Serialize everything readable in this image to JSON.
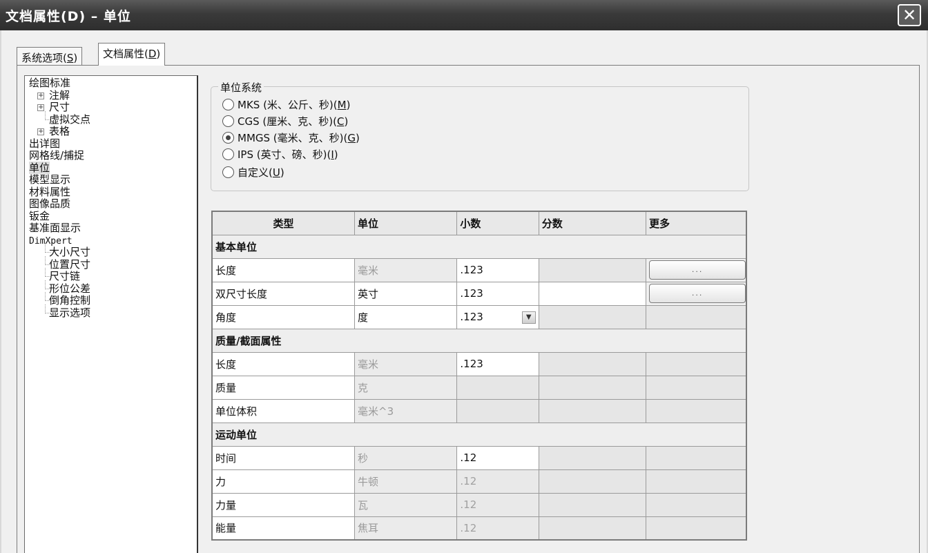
{
  "window": {
    "title": "文档属性(D) – 单位"
  },
  "tabs": [
    "系统选项(S)",
    "文档属性(D)"
  ],
  "tree": {
    "items": [
      {
        "label": "绘图标准",
        "level": 0
      },
      {
        "label": "注解",
        "level": 1,
        "expandable": true
      },
      {
        "label": "尺寸",
        "level": 1,
        "expandable": true
      },
      {
        "label": "虚拟交点",
        "level": 1
      },
      {
        "label": "表格",
        "level": 1,
        "expandable": true
      },
      {
        "label": "出详图",
        "level": 0
      },
      {
        "label": "网格线/捕捉",
        "level": 0
      },
      {
        "label": "单位",
        "level": 0,
        "selected": true
      },
      {
        "label": "模型显示",
        "level": 0
      },
      {
        "label": "材料属性",
        "level": 0
      },
      {
        "label": "图像品质",
        "level": 0
      },
      {
        "label": "钣金",
        "level": 0
      },
      {
        "label": "基准面显示",
        "level": 0
      },
      {
        "label": "DimXpert",
        "level": 0
      },
      {
        "label": "大小尺寸",
        "level": 1
      },
      {
        "label": "位置尺寸",
        "level": 1
      },
      {
        "label": "尺寸链",
        "level": 1
      },
      {
        "label": "形位公差",
        "level": 1
      },
      {
        "label": "倒角控制",
        "level": 1
      },
      {
        "label": "显示选项",
        "level": 1
      }
    ]
  },
  "unit_system": {
    "legend": "单位系统",
    "options": [
      {
        "label": "MKS (米、公斤、秒)",
        "key": "M",
        "checked": false
      },
      {
        "label": "CGS (厘米、克、秒)",
        "key": "C",
        "checked": false
      },
      {
        "label": "MMGS (毫米、克、秒)",
        "key": "G",
        "checked": true
      },
      {
        "label": "IPS (英寸、磅、秒)",
        "key": "I",
        "checked": false
      },
      {
        "label": "自定义",
        "key": "U",
        "checked": false
      }
    ]
  },
  "grid": {
    "headers": [
      "类型",
      "单位",
      "小数",
      "分数",
      "更多"
    ],
    "more_button_label": "...",
    "sections": [
      {
        "title": "基本单位",
        "rows": [
          {
            "type": "长度",
            "unit": "毫米",
            "unit_editable": false,
            "decimal": ".123",
            "decimal_editable": true,
            "fraction_editable": false,
            "has_more": true
          },
          {
            "type": "双尺寸长度",
            "unit": "英寸",
            "unit_editable": true,
            "decimal": ".123",
            "decimal_editable": true,
            "fraction_editable": true,
            "has_more": true
          },
          {
            "type": "角度",
            "unit": "度",
            "unit_editable": true,
            "decimal": ".123",
            "decimal_editable": true,
            "decimal_dropdown": true,
            "fraction_editable": false,
            "has_more": false
          }
        ]
      },
      {
        "title": "质量/截面属性",
        "rows": [
          {
            "type": "长度",
            "unit": "毫米",
            "unit_editable": false,
            "decimal": ".123",
            "decimal_editable": true,
            "fraction_editable": false,
            "has_more": false
          },
          {
            "type": "质量",
            "unit": "克",
            "unit_editable": false,
            "decimal": "",
            "decimal_editable": false,
            "fraction_editable": false,
            "has_more": false
          },
          {
            "type": "单位体积",
            "unit": "毫米^3",
            "unit_editable": false,
            "decimal": "",
            "decimal_editable": false,
            "fraction_editable": false,
            "has_more": false
          }
        ]
      },
      {
        "title": "运动单位",
        "rows": [
          {
            "type": "时间",
            "unit": "秒",
            "unit_editable": false,
            "decimal": ".12",
            "decimal_editable": true,
            "fraction_editable": false,
            "has_more": false
          },
          {
            "type": "力",
            "unit": "牛顿",
            "unit_editable": false,
            "decimal": ".12",
            "decimal_editable": false,
            "fraction_editable": false,
            "has_more": false
          },
          {
            "type": "力量",
            "unit": "瓦",
            "unit_editable": false,
            "decimal": ".12",
            "decimal_editable": false,
            "fraction_editable": false,
            "has_more": false
          },
          {
            "type": "能量",
            "unit": "焦耳",
            "unit_editable": false,
            "decimal": ".12",
            "decimal_editable": false,
            "fraction_editable": false,
            "has_more": false
          }
        ]
      }
    ]
  }
}
